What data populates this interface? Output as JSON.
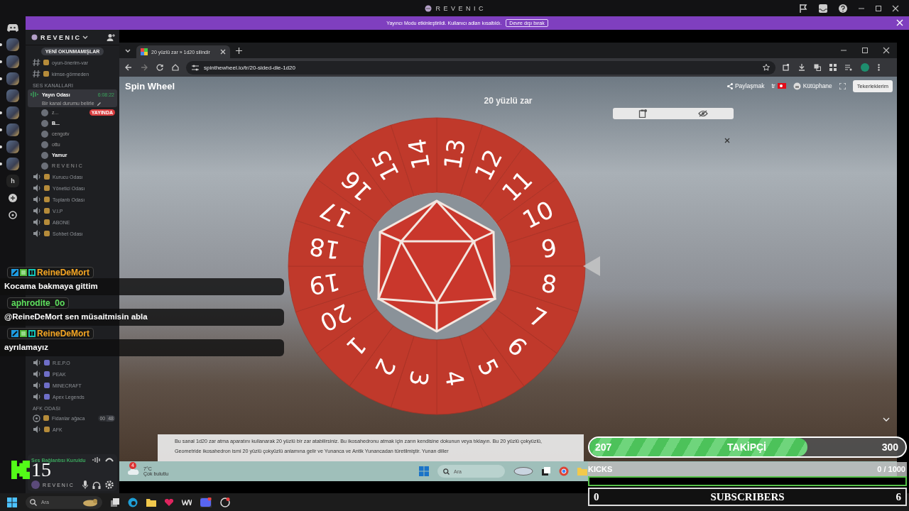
{
  "top_bar": {
    "title": "R E V E N I C"
  },
  "banner": {
    "message": "Yayıncı Modu etkinleştirildi. Kullanıcı adları kısaltıldı.",
    "button": "Devre dışı bırak"
  },
  "server_rail": [
    {
      "kind": "logo",
      "unread": false
    },
    {
      "kind": "server",
      "unread": true
    },
    {
      "kind": "server",
      "unread": true
    },
    {
      "kind": "server",
      "unread": true
    },
    {
      "kind": "server",
      "unread": false
    },
    {
      "kind": "server",
      "unread": true
    },
    {
      "kind": "server",
      "unread": true
    },
    {
      "kind": "server",
      "unread": true
    },
    {
      "kind": "server",
      "unread": true
    },
    {
      "kind": "letter",
      "label": "h",
      "unread": false
    },
    {
      "kind": "add",
      "unread": false
    },
    {
      "kind": "discover",
      "unread": false
    }
  ],
  "sidebar": {
    "server_name": "R E V E N I C",
    "unread_pill": "YENİ OKUNMAMIŞLAR",
    "text_channels": [
      {
        "name": "oyun-önerim-var"
      },
      {
        "name": "kimse-görmeden"
      }
    ],
    "voice_category": "SES KANALLARI",
    "active_channel": {
      "name": "Yayın Odası",
      "timer": "6:08:22",
      "status": "Bir kanal durumu belirle",
      "members": [
        {
          "name": "z...",
          "badge": "YAYINDA",
          "bold": false
        },
        {
          "name": "B...",
          "bold": true
        },
        {
          "name": "cengotv",
          "bold": false
        },
        {
          "name": "ottu",
          "bold": false
        },
        {
          "name": "Yamur",
          "bold": true
        },
        {
          "name": "R E V E N I C",
          "bold": false
        }
      ]
    },
    "voice_channels": [
      {
        "name": "Kurucu Odası"
      },
      {
        "name": "Yönetici Odası"
      },
      {
        "name": "Toplantı Odası"
      },
      {
        "name": "V.I.P"
      },
      {
        "name": "ABONE"
      },
      {
        "name": "Sohbet Odası"
      }
    ],
    "game_channels": [
      {
        "name": "R.E.P.O"
      },
      {
        "name": "PEAK"
      },
      {
        "name": "MINECRAFT"
      },
      {
        "name": "Apex Legends"
      }
    ],
    "afk_category": "AFK ODASI",
    "afk_channels": [
      {
        "name": "Fidanlar ağaca",
        "kind": "stage",
        "count": "00",
        "limit": "48"
      },
      {
        "name": "AFK",
        "kind": "voice"
      }
    ],
    "voice_panel": {
      "status": "Ses Bağlantısı Kuruldu",
      "username": "R E V E N I C"
    }
  },
  "browser": {
    "tab": {
      "title": "20 yüzlü zar » 1d20 silindir"
    },
    "url": "spinthewheel.io/tr/20-sided-die-1d20",
    "page": {
      "logo": "Spin Wheel",
      "share": "Paylaşmak",
      "language": "tr",
      "library": "Kütüphane",
      "my_wheels": "Tekerleklerim",
      "title": "20 yüzlü zar",
      "wheel": {
        "labels": [
          "13",
          "12",
          "11",
          "10",
          "9",
          "8",
          "7",
          "6",
          "5",
          "4",
          "3",
          "2",
          "1",
          "20",
          "19",
          "18",
          "17",
          "16",
          "15",
          "14"
        ]
      },
      "description": [
        "Bu sanal 1d20 zar atma aparatını kullanarak 20 yüzlü bir zar atabilirsiniz. Bu ikosahedronu atmak için zarın kendisine dokunun veya tıklayın. Bu 20 yüzlü çokyüzlü,",
        "Geometride ikosahedron ismi 20 yüzlü çokyüzlü anlamına gelir ve Yunanca ve Antik Yunancadan türetilmiştir. Yunan diller"
      ]
    },
    "inner_taskbar": {
      "weather": {
        "badge": "4",
        "temp": "7°C",
        "condition": "Çok bulutlu"
      },
      "search": {
        "placeholder": "Ara"
      }
    }
  },
  "chat": [
    {
      "user": "ReineDeMort",
      "color": "#f5a623",
      "badges": true,
      "text": "Kocama bakmaya gittim"
    },
    {
      "user": "aphrodite_0o",
      "color": "#5ee05e",
      "badges": false,
      "text": "@ReineDeMort sen müsaitmisin abla"
    },
    {
      "user": "ReineDeMort",
      "color": "#f5a623",
      "badges": true,
      "text": "ayrılamayız"
    }
  ],
  "kick_counter": {
    "value": "15"
  },
  "follower_goal": {
    "current": "207",
    "label": "TAKİPÇİ",
    "target": "300",
    "level": 0.69
  },
  "kicks_goal": {
    "label": "KICKS",
    "progress": "0 / 1000",
    "level": 0
  },
  "subscriber_goal": {
    "current": "0",
    "label": "SUBSCRIBERS",
    "target": "6"
  },
  "taskbar": {
    "search": {
      "placeholder": "Ara"
    }
  }
}
